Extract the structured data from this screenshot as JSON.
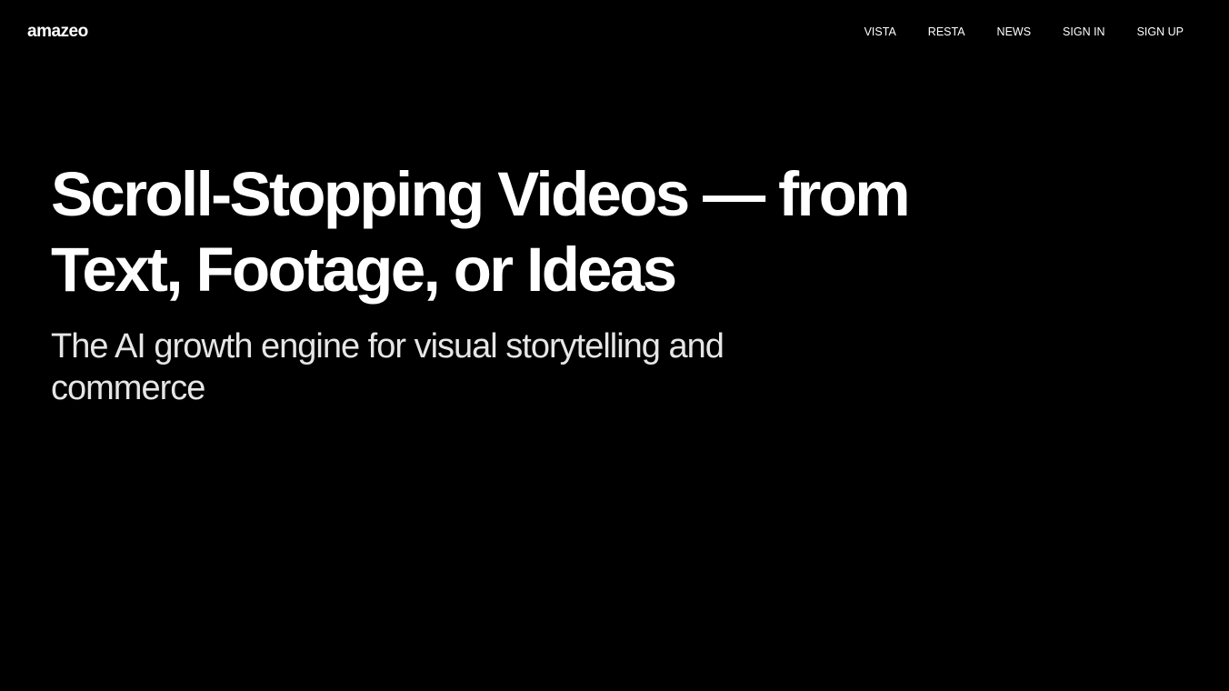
{
  "header": {
    "logo_text": "amazeo",
    "nav": [
      {
        "label": "VISTA"
      },
      {
        "label": "RESTA"
      },
      {
        "label": "NEWS"
      },
      {
        "label": "SIGN IN"
      },
      {
        "label": "SIGN UP"
      }
    ]
  },
  "hero": {
    "title_line1": "Scroll-Stopping Videos — from",
    "title_line2": "Text, Footage, or Ideas",
    "subtitle": "The AI growth engine for visual storytelling and commerce"
  },
  "colors": {
    "background": "#000000",
    "text": "#ffffff",
    "subtitle": "#e6e6e6"
  }
}
